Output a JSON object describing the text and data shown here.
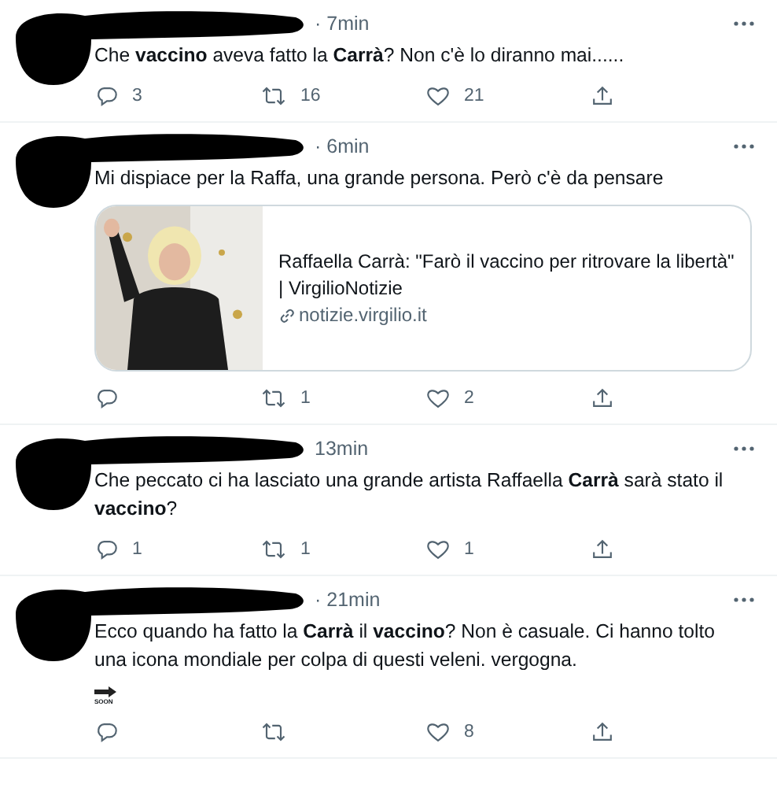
{
  "tweets": [
    {
      "time": "· 7min",
      "text": "Che **vaccino** aveva fatto la **Carrà**? Non c'è lo diranno mai......",
      "actions": [
        {
          "kind": "reply",
          "count": "3"
        },
        {
          "kind": "retweet",
          "count": "16"
        },
        {
          "kind": "like",
          "count": "21"
        },
        {
          "kind": "share"
        }
      ]
    },
    {
      "time": "· 6min",
      "text": "Mi dispiace per la Raffa, una grande persona. Però c'è da pensare",
      "card": {
        "kind": "picture",
        "title": "Raffaella Carrà: \"Farò il vaccino per ritrovare la libertà\" | VirgilioNotizie",
        "domain": "notizie.virgilio.it"
      },
      "actions": [
        {
          "kind": "reply"
        },
        {
          "kind": "retweet",
          "count": "1"
        },
        {
          "kind": "like",
          "count": "2"
        },
        {
          "kind": "share"
        }
      ]
    },
    {
      "time": "13min",
      "text": "Che peccato ci ha lasciato una grande artista Raffaella **Carrà** sarà stato il **vaccino**?",
      "actions": [
        {
          "kind": "reply",
          "count": "1"
        },
        {
          "kind": "retweet",
          "count": "1"
        },
        {
          "kind": "like",
          "count": "1"
        },
        {
          "kind": "share"
        }
      ]
    },
    {
      "time": "· 21min",
      "text": "Ecco quando ha fatto la **Carrà** il **vaccino**? Non è casuale. Ci hanno tolto una icona mondiale per colpa di questi veleni. vergogna.",
      "emoji_label": "SOON",
      "actions": [
        {
          "kind": "reply"
        },
        {
          "kind": "retweet"
        },
        {
          "kind": "like",
          "count": "8"
        },
        {
          "kind": "share"
        }
      ]
    }
  ]
}
